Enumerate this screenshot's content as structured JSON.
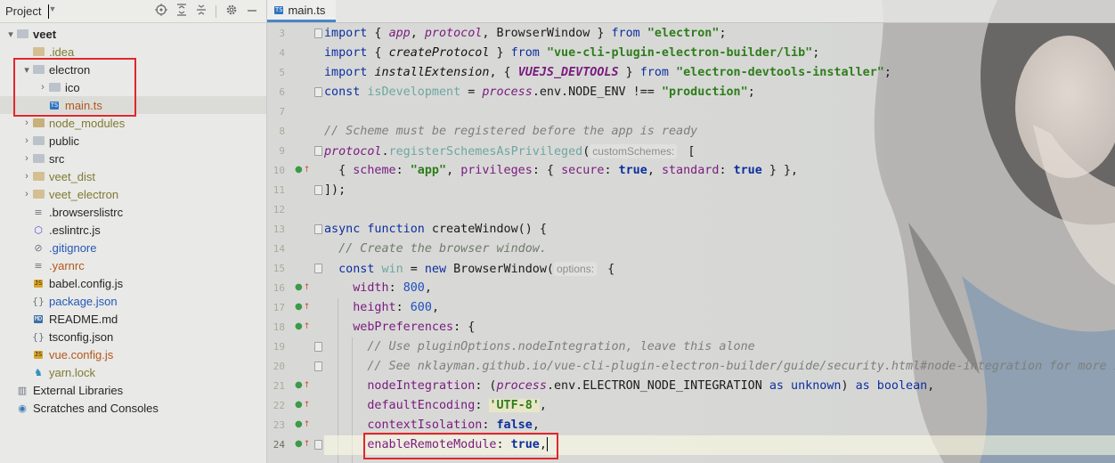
{
  "project_panel": {
    "title": "Project",
    "tree": [
      {
        "label": "veet",
        "suffix": "",
        "depth": 0,
        "arrow": "▾",
        "kind": "folder",
        "style": "bold"
      },
      {
        "label": ".idea",
        "depth": 1,
        "arrow": "",
        "kind": "folder-excluded",
        "style": "olive"
      },
      {
        "label": "electron",
        "depth": 1,
        "arrow": "▾",
        "kind": "folder",
        "style": ""
      },
      {
        "label": "ico",
        "depth": 2,
        "arrow": "›",
        "kind": "folder",
        "style": ""
      },
      {
        "label": "main.ts",
        "depth": 2,
        "arrow": "",
        "kind": "ts",
        "style": "orange",
        "selected": true
      },
      {
        "label": "node_modules",
        "depth": 1,
        "arrow": "›",
        "kind": "folder-module",
        "style": "olive"
      },
      {
        "label": "public",
        "depth": 1,
        "arrow": "›",
        "kind": "folder",
        "style": ""
      },
      {
        "label": "src",
        "depth": 1,
        "arrow": "›",
        "kind": "folder",
        "style": ""
      },
      {
        "label": "veet_dist",
        "depth": 1,
        "arrow": "›",
        "kind": "folder-excluded",
        "style": "olive"
      },
      {
        "label": "veet_electron",
        "depth": 1,
        "arrow": "›",
        "kind": "folder-excluded",
        "style": "olive"
      },
      {
        "label": ".browserslistrc",
        "depth": 1,
        "arrow": "",
        "kind": "text",
        "style": ""
      },
      {
        "label": ".eslintrc.js",
        "depth": 1,
        "arrow": "",
        "kind": "eslint",
        "style": ""
      },
      {
        "label": ".gitignore",
        "depth": 1,
        "arrow": "",
        "kind": "git",
        "style": "blue"
      },
      {
        "label": ".yarnrc",
        "depth": 1,
        "arrow": "",
        "kind": "text",
        "style": "orange"
      },
      {
        "label": "babel.config.js",
        "depth": 1,
        "arrow": "",
        "kind": "js",
        "style": ""
      },
      {
        "label": "package.json",
        "depth": 1,
        "arrow": "",
        "kind": "json",
        "style": "blue"
      },
      {
        "label": "README.md",
        "depth": 1,
        "arrow": "",
        "kind": "md",
        "style": ""
      },
      {
        "label": "tsconfig.json",
        "depth": 1,
        "arrow": "",
        "kind": "json",
        "style": ""
      },
      {
        "label": "vue.config.js",
        "depth": 1,
        "arrow": "",
        "kind": "js",
        "style": "orange"
      },
      {
        "label": "yarn.lock",
        "depth": 1,
        "arrow": "",
        "kind": "yarn",
        "style": "olive"
      },
      {
        "label": "External Libraries",
        "depth": 0,
        "arrow": "",
        "kind": "libs",
        "style": ""
      },
      {
        "label": "Scratches and Consoles",
        "depth": 0,
        "arrow": "",
        "kind": "scratch",
        "style": ""
      }
    ]
  },
  "editor": {
    "tab_label": "main.ts",
    "tab_badge": "TS",
    "line_numbers": [
      "3",
      "4",
      "5",
      "6",
      "7",
      "8",
      "9",
      "10",
      "11",
      "12",
      "13",
      "14",
      "15",
      "16",
      "17",
      "18",
      "19",
      "20",
      "21",
      "22",
      "23",
      "24"
    ],
    "lines": {
      "l3": {
        "kw": "import",
        "a": " { ",
        "b": "app",
        "c": ", ",
        "d": "protocol",
        "e": ", BrowserWindow } ",
        "f": "from",
        "g": " ",
        "h": "\"electron\"",
        "i": ";"
      },
      "l4": {
        "kw": "import",
        "a": " { ",
        "b": "createProtocol",
        "c": " } ",
        "d": "from",
        "e": " ",
        "f": "\"vue-cli-plugin-electron-builder/lib\"",
        "g": ";"
      },
      "l5": {
        "kw": "import",
        "a": " ",
        "b": "installExtension",
        "c": ", { ",
        "d": "VUEJS_DEVTOOLS",
        "e": " } ",
        "f": "from",
        "g": " ",
        "h": "\"electron-devtools-installer\"",
        "i": ";"
      },
      "l6": {
        "kw": "const",
        "a": " ",
        "b": "isDevelopment",
        "c": " = ",
        "d": "process",
        "e": ".env.",
        "f": "NODE_ENV",
        "g": " !== ",
        "h": "\"production\"",
        "i": ";"
      },
      "l8": {
        "cmt": "// Scheme must be registered before the app is ready"
      },
      "l9": {
        "a": "protocol",
        "b": ".",
        "c": "registerSchemesAsPrivileged",
        "d": "(",
        "hint": "customSchemes:",
        "e": " ["
      },
      "l10": {
        "a": "  { ",
        "b": "scheme",
        "c": ": ",
        "d": "\"app\"",
        "e": ", ",
        "f": "privileges",
        "g": ": { ",
        "h": "secure",
        "i": ": ",
        "j": "true",
        "k": ", ",
        "l": "standard",
        "m": ": ",
        "n": "true",
        "o": " } },"
      },
      "l11": {
        "a": "]);"
      },
      "l13": {
        "kw": "async",
        "a": " ",
        "kw2": "function",
        "b": " createWindow() {"
      },
      "l14": {
        "cmt": "  // Create the browser window."
      },
      "l15": {
        "kw": "  const",
        "a": " ",
        "b": "win",
        "c": " = ",
        "kw2": "new",
        "d": " BrowserWindow(",
        "hint": "options:",
        "e": " {"
      },
      "l16": {
        "a": "    ",
        "b": "width",
        "c": ": ",
        "d": "800",
        "e": ","
      },
      "l17": {
        "a": "    ",
        "b": "height",
        "c": ": ",
        "d": "600",
        "e": ","
      },
      "l18": {
        "a": "    ",
        "b": "webPreferences",
        "c": ": {"
      },
      "l19": {
        "cmt": "      // Use pluginOptions.nodeIntegration, leave this alone"
      },
      "l20": {
        "cmt": "      // See nklayman.github.io/vue-cli-plugin-electron-builder/guide/security.html#node-integration for more i"
      },
      "l21": {
        "a": "      ",
        "b": "nodeIntegration",
        "c": ": (",
        "d": "process",
        "e": ".env.",
        "f": "ELECTRON_NODE_INTEGRATION",
        "g": " ",
        "h": "as",
        "i": " ",
        "j": "unknown",
        "k": ") ",
        "l": "as",
        "m": " ",
        "n": "boolean",
        "o": ","
      },
      "l22": {
        "a": "      ",
        "b": "defaultEncoding",
        "c": ": ",
        "d": "'UTF-8'",
        "e": ","
      },
      "l23": {
        "a": "      ",
        "b": "contextIsolation",
        "c": ": ",
        "d": "false",
        "e": ","
      },
      "l24": {
        "a": "      ",
        "b": "enableRemoteModule",
        "c": ": ",
        "d": "true",
        "e": ","
      }
    }
  },
  "colors": {
    "highlight_box": "#e1262c",
    "tab_underline": "#4a86c8",
    "keyword": "#0d2f9e",
    "string": "#2e7d1b",
    "property": "#7a1a7e",
    "comment": "#7e7e7e"
  }
}
